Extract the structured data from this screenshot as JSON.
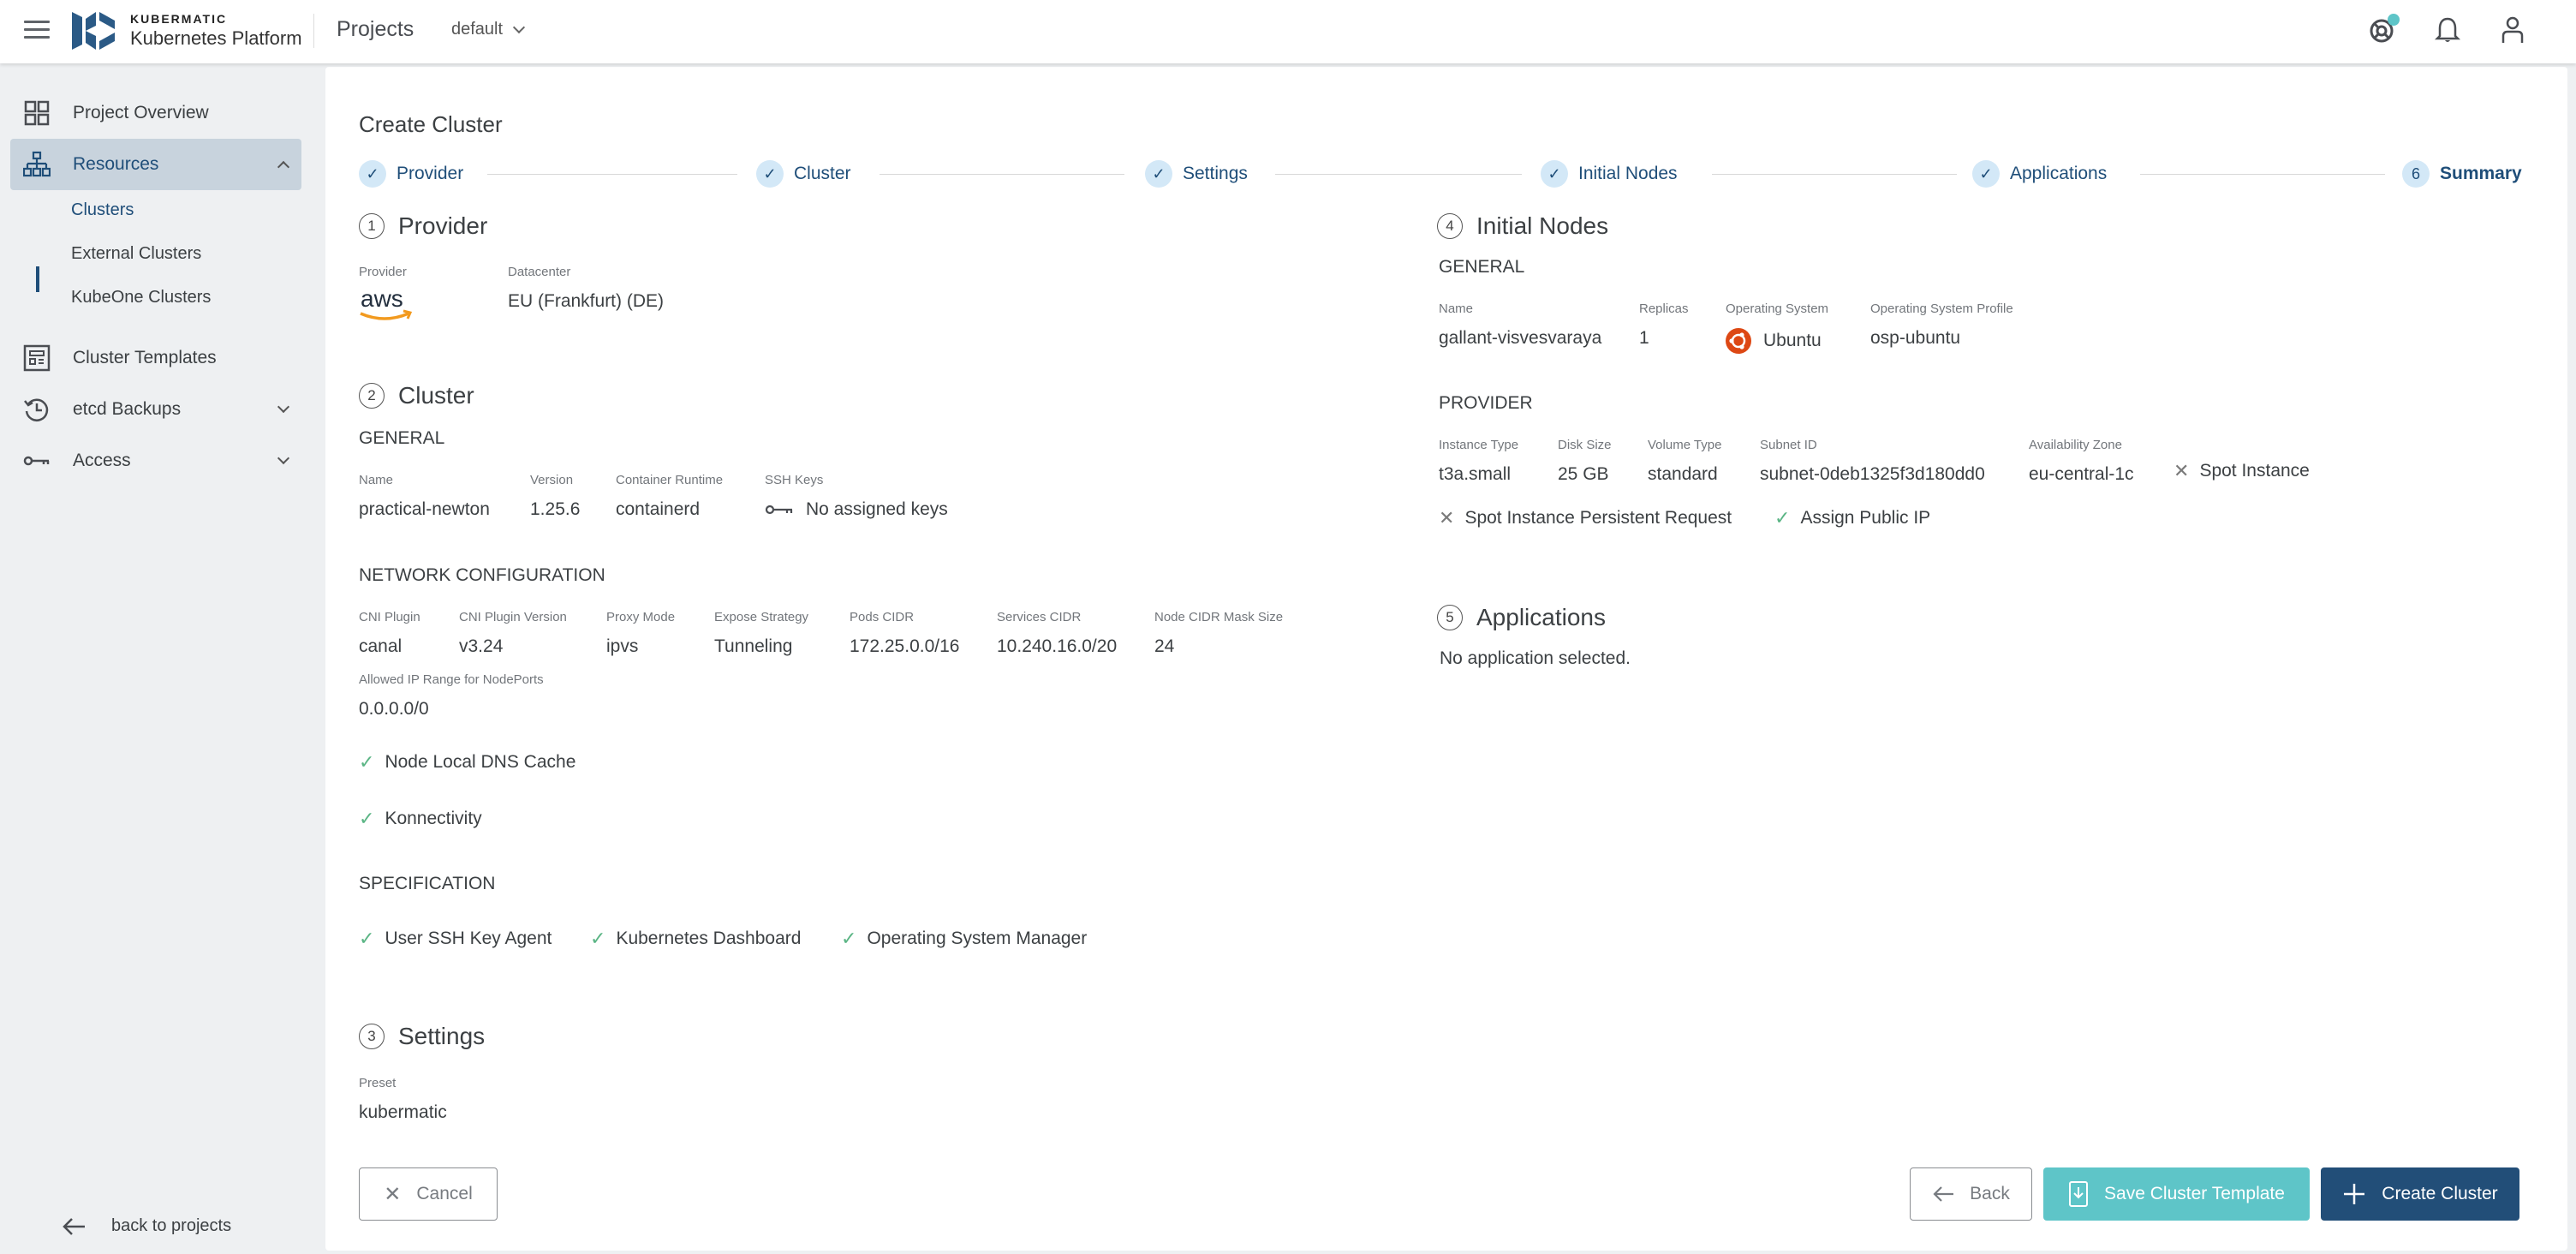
{
  "topbar": {
    "brand_small": "KUBERMATIC",
    "brand_big": "Kubernetes Platform",
    "section_title": "Projects",
    "project_selected": "default",
    "icons": [
      "menu-icon",
      "help-lifebuoy-icon",
      "notifications-bell-icon",
      "account-person-icon"
    ],
    "help_badge_color": "#5ec5c8"
  },
  "sidebar": {
    "items": [
      {
        "label": "Project Overview",
        "icon": "grid-icon"
      },
      {
        "label": "Resources",
        "icon": "sitemap-icon",
        "expanded": true,
        "active": true
      },
      {
        "label": "Cluster Templates",
        "icon": "template-icon"
      },
      {
        "label": "etcd Backups",
        "icon": "history-icon",
        "expanded": false
      },
      {
        "label": "Access",
        "icon": "key-icon",
        "expanded": false
      }
    ],
    "sub_items": [
      {
        "label": "Clusters",
        "active": true
      },
      {
        "label": "External Clusters"
      },
      {
        "label": "KubeOne Clusters"
      }
    ],
    "back_label": "back to projects"
  },
  "main": {
    "title": "Create Cluster",
    "steps": [
      {
        "label": "Provider",
        "state": "done"
      },
      {
        "label": "Cluster",
        "state": "done"
      },
      {
        "label": "Settings",
        "state": "done"
      },
      {
        "label": "Initial Nodes",
        "state": "done"
      },
      {
        "label": "Applications",
        "state": "done"
      },
      {
        "label": "Summary",
        "state": "current",
        "number": "6"
      }
    ],
    "provider_section": {
      "number": "1",
      "title": "Provider",
      "provider_label": "Provider",
      "provider_value": "aws",
      "datacenter_label": "Datacenter",
      "datacenter_value": "EU (Frankfurt) (DE)"
    },
    "cluster_section": {
      "number": "2",
      "title": "Cluster",
      "general_heading": "GENERAL",
      "general": [
        {
          "label": "Name",
          "value": "practical-newton"
        },
        {
          "label": "Version",
          "value": "1.25.6"
        },
        {
          "label": "Container Runtime",
          "value": "containerd"
        },
        {
          "label": "SSH Keys",
          "value": "No assigned keys"
        }
      ],
      "network_heading": "NETWORK CONFIGURATION",
      "network": [
        {
          "label": "CNI Plugin",
          "value": "canal"
        },
        {
          "label": "CNI Plugin Version",
          "value": "v3.24"
        },
        {
          "label": "Proxy Mode",
          "value": "ipvs"
        },
        {
          "label": "Expose Strategy",
          "value": "Tunneling"
        },
        {
          "label": "Pods CIDR",
          "value": "172.25.0.0/16"
        },
        {
          "label": "Services CIDR",
          "value": "10.240.16.0/20"
        },
        {
          "label": "Node CIDR Mask Size",
          "value": "24"
        }
      ],
      "allowed_ip": {
        "label": "Allowed IP Range for NodePorts",
        "value": "0.0.0.0/0"
      },
      "flags": [
        {
          "label": "Node Local DNS Cache",
          "enabled": true
        },
        {
          "label": "Konnectivity",
          "enabled": true
        }
      ],
      "spec_heading": "SPECIFICATION",
      "spec": [
        {
          "label": "User SSH Key Agent",
          "enabled": true
        },
        {
          "label": "Kubernetes Dashboard",
          "enabled": true
        },
        {
          "label": "Operating System Manager",
          "enabled": true
        }
      ]
    },
    "settings_section": {
      "number": "3",
      "title": "Settings",
      "preset_label": "Preset",
      "preset_value": "kubermatic"
    },
    "nodes_section": {
      "number": "4",
      "title": "Initial Nodes",
      "general_heading": "GENERAL",
      "general": [
        {
          "label": "Name",
          "value": "gallant-visvesvaraya"
        },
        {
          "label": "Replicas",
          "value": "1"
        },
        {
          "label": "Operating System",
          "value": "Ubuntu"
        },
        {
          "label": "Operating System Profile",
          "value": "osp-ubuntu"
        }
      ],
      "provider_heading": "PROVIDER",
      "provider": [
        {
          "label": "Instance Type",
          "value": "t3a.small"
        },
        {
          "label": "Disk Size",
          "value": "25 GB"
        },
        {
          "label": "Volume Type",
          "value": "standard"
        },
        {
          "label": "Subnet ID",
          "value": "subnet-0deb1325f3d180dd0"
        },
        {
          "label": "Availability Zone",
          "value": "eu-central-1c"
        }
      ],
      "flags": [
        {
          "label": "Spot Instance",
          "enabled": false
        },
        {
          "label": "Spot Instance Persistent Request",
          "enabled": false
        },
        {
          "label": "Assign Public IP",
          "enabled": true
        }
      ]
    },
    "apps_section": {
      "number": "5",
      "title": "Applications",
      "empty_text": "No application selected."
    },
    "buttons": {
      "cancel": "Cancel",
      "back": "Back",
      "save_template": "Save Cluster Template",
      "create": "Create Cluster"
    }
  },
  "colors": {
    "primary": "#224e78",
    "teal": "#5ec5c8",
    "check_green": "#5bb585",
    "step_circle_bg": "#d3e8f7",
    "ubuntu_orange": "#dd4814",
    "aws_orange": "#f29a1f"
  }
}
